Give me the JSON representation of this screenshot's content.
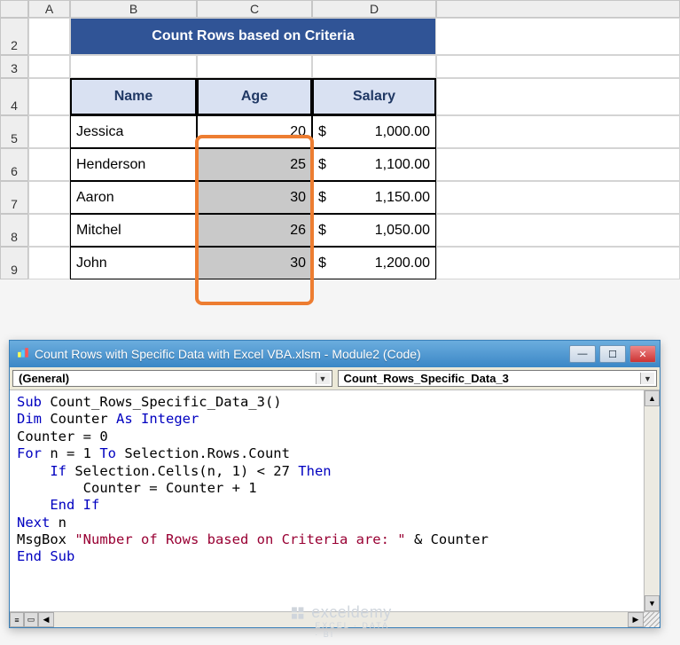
{
  "col_letters": {
    "a": "A",
    "b": "B",
    "c": "C",
    "d": "D"
  },
  "row_nums": {
    "r2": "2",
    "r3": "3",
    "r4": "4",
    "r5": "5",
    "r6": "6",
    "r7": "7",
    "r8": "8",
    "r9": "9"
  },
  "title": "Count Rows based on Criteria",
  "headers": {
    "name": "Name",
    "age": "Age",
    "salary": "Salary"
  },
  "rows": [
    {
      "name": "Jessica",
      "age": "20",
      "salary": "1,000.00"
    },
    {
      "name": "Henderson",
      "age": "25",
      "salary": "1,100.00"
    },
    {
      "name": "Aaron",
      "age": "30",
      "salary": "1,150.00"
    },
    {
      "name": "Mitchel",
      "age": "26",
      "salary": "1,050.00"
    },
    {
      "name": "John",
      "age": "30",
      "salary": "1,200.00"
    }
  ],
  "currency_symbol": "$",
  "vba": {
    "title": "Count Rows with Specific Data with Excel VBA.xlsm - Module2 (Code)",
    "left_combo": "(General)",
    "right_combo": "Count_Rows_Specific_Data_3",
    "code": {
      "l1a": "Sub",
      "l1b": " Count_Rows_Specific_Data_3()",
      "l2a": "Dim",
      "l2b": " Counter ",
      "l2c": "As Integer",
      "l3": "Counter = 0",
      "l4a": "For",
      "l4b": " n = 1 ",
      "l4c": "To",
      "l4d": " Selection.Rows.Count",
      "l5a": "    ",
      "l5b": "If",
      "l5c": " Selection.Cells(n, 1) < 27 ",
      "l5d": "Then",
      "l6": "        Counter = Counter + 1",
      "l7a": "    ",
      "l7b": "End If",
      "l8a": "Next",
      "l8b": " n",
      "l9a": "MsgBox ",
      "l9b": "\"Number of Rows based on Criteria are: \"",
      "l9c": " & Counter",
      "l10": "End Sub"
    }
  },
  "watermark": {
    "brand": "exceldemy",
    "tag": "EXCEL · DATA · BI"
  },
  "chart_data": {
    "type": "table",
    "title": "Count Rows based on Criteria",
    "columns": [
      "Name",
      "Age",
      "Salary"
    ],
    "rows": [
      [
        "Jessica",
        20,
        1000.0
      ],
      [
        "Henderson",
        25,
        1100.0
      ],
      [
        "Aaron",
        30,
        1150.0
      ],
      [
        "Mitchel",
        26,
        1050.0
      ],
      [
        "John",
        30,
        1200.0
      ]
    ],
    "selection": {
      "column": "Age",
      "values": [
        20,
        25,
        30,
        26,
        30
      ]
    },
    "criteria": "Age < 27"
  }
}
